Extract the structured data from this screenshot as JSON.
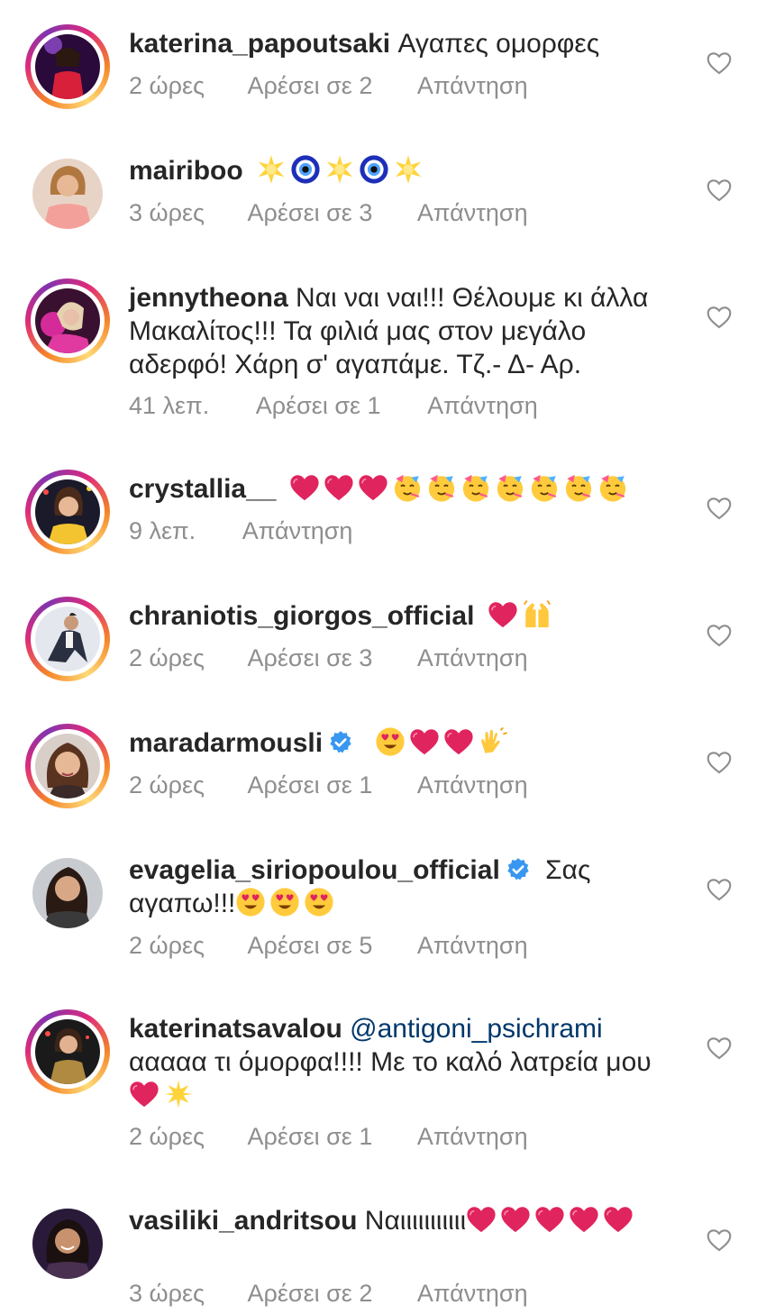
{
  "colors": {
    "text": "#262626",
    "meta": "#8e8e8e",
    "mention": "#00376b",
    "verified": "#3897f0",
    "heart_emoji": "#e0245e"
  },
  "reply_label": "Απάντηση",
  "comments": [
    {
      "username": "katerina_papoutsaki",
      "text": "Αγαπες ομορφες",
      "time": "2 ώρες",
      "likes": "Αρέσει σε 2",
      "reply": "Απάντηση",
      "emojis": []
    },
    {
      "username": "mairiboo",
      "text": "",
      "time": "3 ώρες",
      "likes": "Αρέσει σε 3",
      "reply": "Απάντηση",
      "emojis": [
        "star",
        "nazar",
        "star",
        "nazar",
        "star"
      ]
    },
    {
      "username": "jennytheona",
      "text": "Ναι ναι ναι!!! Θέλουμε κι άλλα Μακαλίτος!!! Τα φιλιά μας στον μεγάλο αδερφό! Χάρη σ' αγαπάμε. Τζ.- Δ- Αρ.",
      "time": "41 λεπ.",
      "likes": "Αρέσει σε 1",
      "reply": "Απάντηση",
      "emojis": []
    },
    {
      "username": "crystallia__",
      "text": "",
      "time": "9 λεπ.",
      "likes": "",
      "reply": "Απάντηση",
      "emojis": [
        "heart",
        "heart",
        "heart",
        "party",
        "party",
        "party",
        "party",
        "party",
        "party",
        "party"
      ]
    },
    {
      "username": "chraniotis_giorgos_official",
      "text": "",
      "time": "2 ώρες",
      "likes": "Αρέσει σε 3",
      "reply": "Απάντηση",
      "emojis": [
        "heart",
        "raised-hands"
      ]
    },
    {
      "username": "maradarmousli",
      "text": "",
      "time": "2 ώρες",
      "likes": "Αρέσει σε 1",
      "reply": "Απάντηση",
      "verified": true,
      "emojis": [
        "heart-eyes",
        "heart",
        "heart",
        "clap"
      ]
    },
    {
      "username": "evagelia_siriopoulou_official",
      "text": "Σας αγαπω!!!",
      "time": "2 ώρες",
      "likes": "Αρέσει σε 5",
      "reply": "Απάντηση",
      "verified": true,
      "emojis": [
        "heart-eyes",
        "heart-eyes",
        "heart-eyes"
      ]
    },
    {
      "username": "katerinatsavalou",
      "mention": "@antigoni_psichrami",
      "text": "ααααα τι όμορφα!!!! Με το καλό λατρεία μου",
      "time": "2 ώρες",
      "likes": "Αρέσει σε 1",
      "reply": "Απάντηση",
      "emojis": [
        "heart",
        "sparkle"
      ]
    },
    {
      "username": "vasiliki_andritsou",
      "text": "Ναιιιιιιιιιιι",
      "time": "3 ώρες",
      "likes": "Αρέσει σε 2",
      "reply": "Απάντηση",
      "emojis": [
        "heart",
        "heart",
        "heart",
        "heart",
        "heart"
      ]
    }
  ]
}
